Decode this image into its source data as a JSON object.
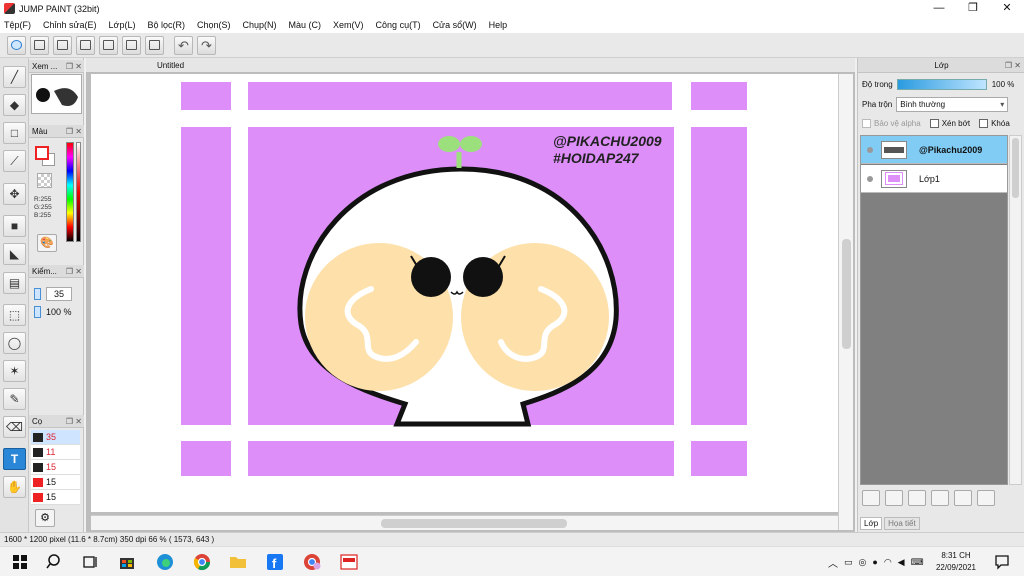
{
  "window": {
    "title": "JUMP PAINT (32bit)",
    "controls": [
      "—",
      "❐",
      "✕"
    ]
  },
  "menu": [
    "Tệp(F)",
    "Chỉnh sửa(E)",
    "Lớp(L)",
    "Bộ lọc(R)",
    "Chọn(S)",
    "Chụp(N)",
    "Màu (C)",
    "Xem(V)",
    "Công cụ(T)",
    "Cửa sổ(W)",
    "Help"
  ],
  "toolbar": {
    "undo_label": "↶",
    "redo_label": "↷"
  },
  "left_panels": {
    "navigator": {
      "title": "Xem ..."
    },
    "color": {
      "title": "Màu",
      "r": "R:255",
      "g": "G:255",
      "b": "B:255",
      "fg_color": "#e02222",
      "bg_color": "#ffffff"
    },
    "brush_size": {
      "title": "Kiểm...",
      "size": "35",
      "opacity": "100 %"
    },
    "brush_list": {
      "title": "Cọ",
      "items": [
        {
          "value": "35",
          "color": "#222222"
        },
        {
          "value": "11",
          "color": "#222222"
        },
        {
          "value": "15",
          "color": "#222222"
        },
        {
          "value": "15",
          "color": "#e02222"
        },
        {
          "value": "15",
          "color": "#e02222"
        }
      ]
    }
  },
  "document": {
    "tab_title": "Untitled",
    "watermark_line1": "@PIKACHU2009",
    "watermark_line2": "#HOIDAP247",
    "colors": {
      "frame": "#dd8ef9",
      "blush": "#fde0aa",
      "sprout": "#9be07d"
    }
  },
  "layers_panel": {
    "title": "Lớp",
    "opacity_label": "Độ trong",
    "opacity_value": "100 %",
    "blend_label": "Pha trộn",
    "blend_value": "Bình thường",
    "checkboxes": {
      "protect_alpha": "Bảo vệ alpha",
      "clip": "Xén bớt",
      "lock": "Khóa"
    },
    "layers": [
      {
        "name": "@Pikachu2009",
        "selected": true
      },
      {
        "name": "Lớp1",
        "selected": false
      }
    ],
    "tabs": [
      "Lớp",
      "Họa tiết"
    ]
  },
  "status": {
    "text": "1600 * 1200 pixel   (11.6 * 8.7cm)   350 dpi   66 %   ( 1573, 643 )"
  },
  "taskbar": {
    "time": "8:31 CH",
    "date": "22/09/2021"
  }
}
